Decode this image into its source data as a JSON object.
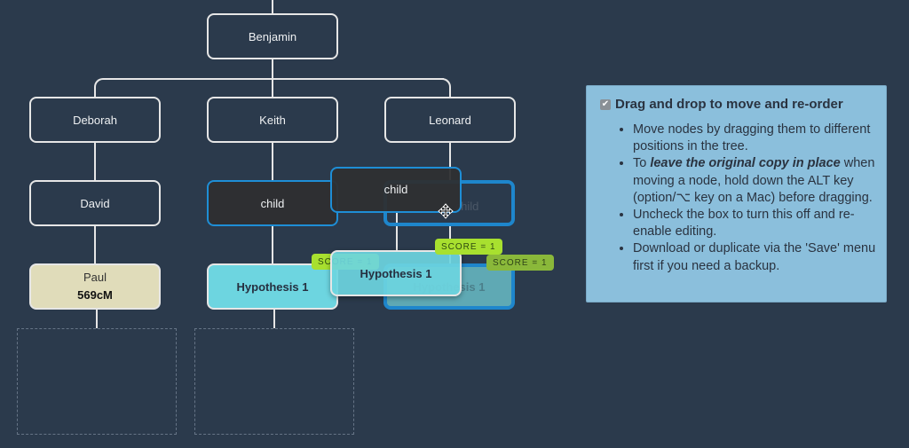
{
  "tree": {
    "root": {
      "name": "Benjamin"
    },
    "generation1": [
      {
        "name": "Deborah"
      },
      {
        "name": "Keith"
      },
      {
        "name": "Leonard"
      }
    ],
    "generation2": [
      {
        "name": "David"
      },
      {
        "name": "child"
      },
      {
        "name": "child",
        "state": "drag-origin"
      }
    ],
    "generation3": [
      {
        "name": "Paul",
        "cm": "569cM"
      },
      {
        "name": "Hypothesis 1",
        "score": "SCORE = 1"
      },
      {
        "name": "Hypothesis 1",
        "score": "SCORE = 1",
        "state": "drag-origin"
      }
    ],
    "dragging": {
      "child": {
        "name": "child"
      },
      "hypothesis": {
        "name": "Hypothesis 1",
        "score": "SCORE = 1"
      }
    }
  },
  "panel": {
    "checkbox_checked": true,
    "title": "Drag and drop to move and re-order",
    "items": [
      {
        "text": "Move nodes by dragging them to different positions in the tree."
      },
      {
        "prefix": "To ",
        "emphasis": "leave the original copy in place",
        "text": " when moving a node, hold down the ALT key (option/⌥ key on a Mac) before dragging."
      },
      {
        "text": "Uncheck the box to turn this off and re-enable editing."
      },
      {
        "text": "Download or duplicate via the 'Save' menu first if you need a backup."
      }
    ]
  },
  "colors": {
    "background": "#2b3a4c",
    "panel": "#8bbfdc",
    "match_node": "#e0dcba",
    "hypothesis_node": "#6dd5e0",
    "selection_border": "#1e8ed6",
    "score_badge": "#a8e02f"
  }
}
